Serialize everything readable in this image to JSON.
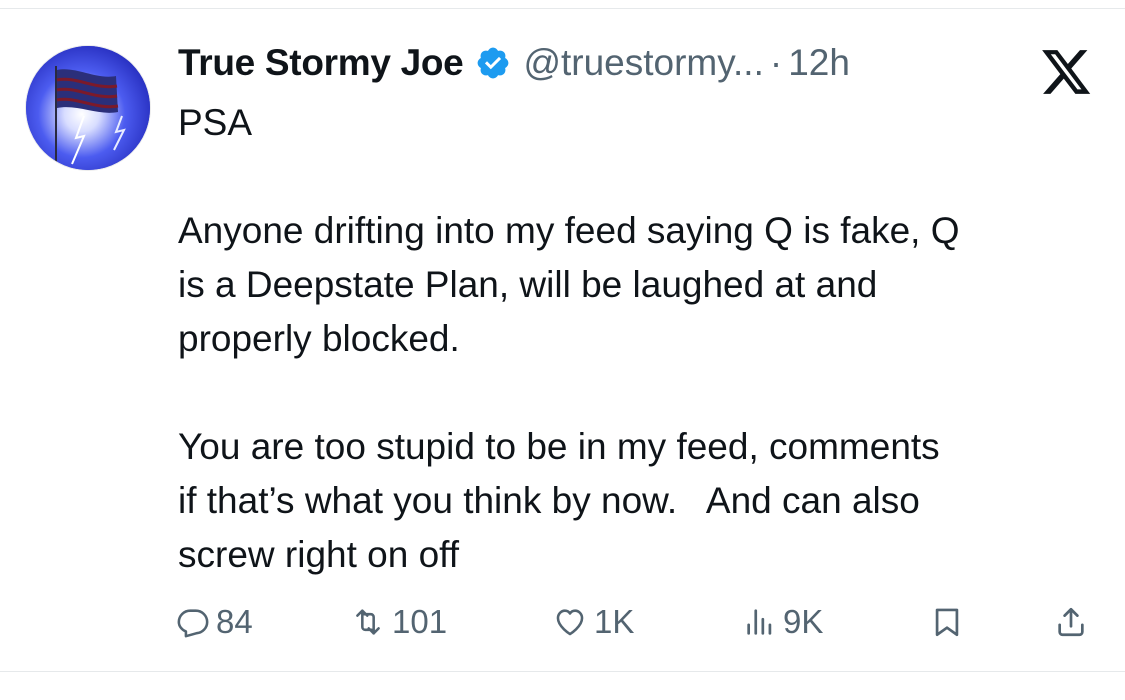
{
  "tweet": {
    "author": {
      "display_name": "True Stormy Joe",
      "handle": "@truestormy...",
      "verified_icon": "verified-badge-icon",
      "avatar": "flag-lightning-avatar"
    },
    "separator": "·",
    "time": "12h",
    "platform_logo": "x-logo-icon",
    "text": "PSA\n\nAnyone drifting into my feed saying Q is fake, Q\nis a Deepstate Plan, will be laughed at and\nproperly blocked.\n\nYou are too stupid to be in my feed, comments\nif that’s what you think by now.   And can also\nscrew right on off",
    "actions": {
      "reply": {
        "icon": "reply-icon",
        "count": "84"
      },
      "retweet": {
        "icon": "retweet-icon",
        "count": "101"
      },
      "like": {
        "icon": "heart-icon",
        "count": "1K"
      },
      "views": {
        "icon": "views-icon",
        "count": "9K"
      },
      "bookmark": {
        "icon": "bookmark-icon"
      },
      "share": {
        "icon": "share-icon"
      }
    }
  },
  "colors": {
    "text_primary": "#0f1419",
    "text_secondary": "#536471",
    "verified_blue": "#1d9bf0",
    "background": "#ffffff"
  }
}
